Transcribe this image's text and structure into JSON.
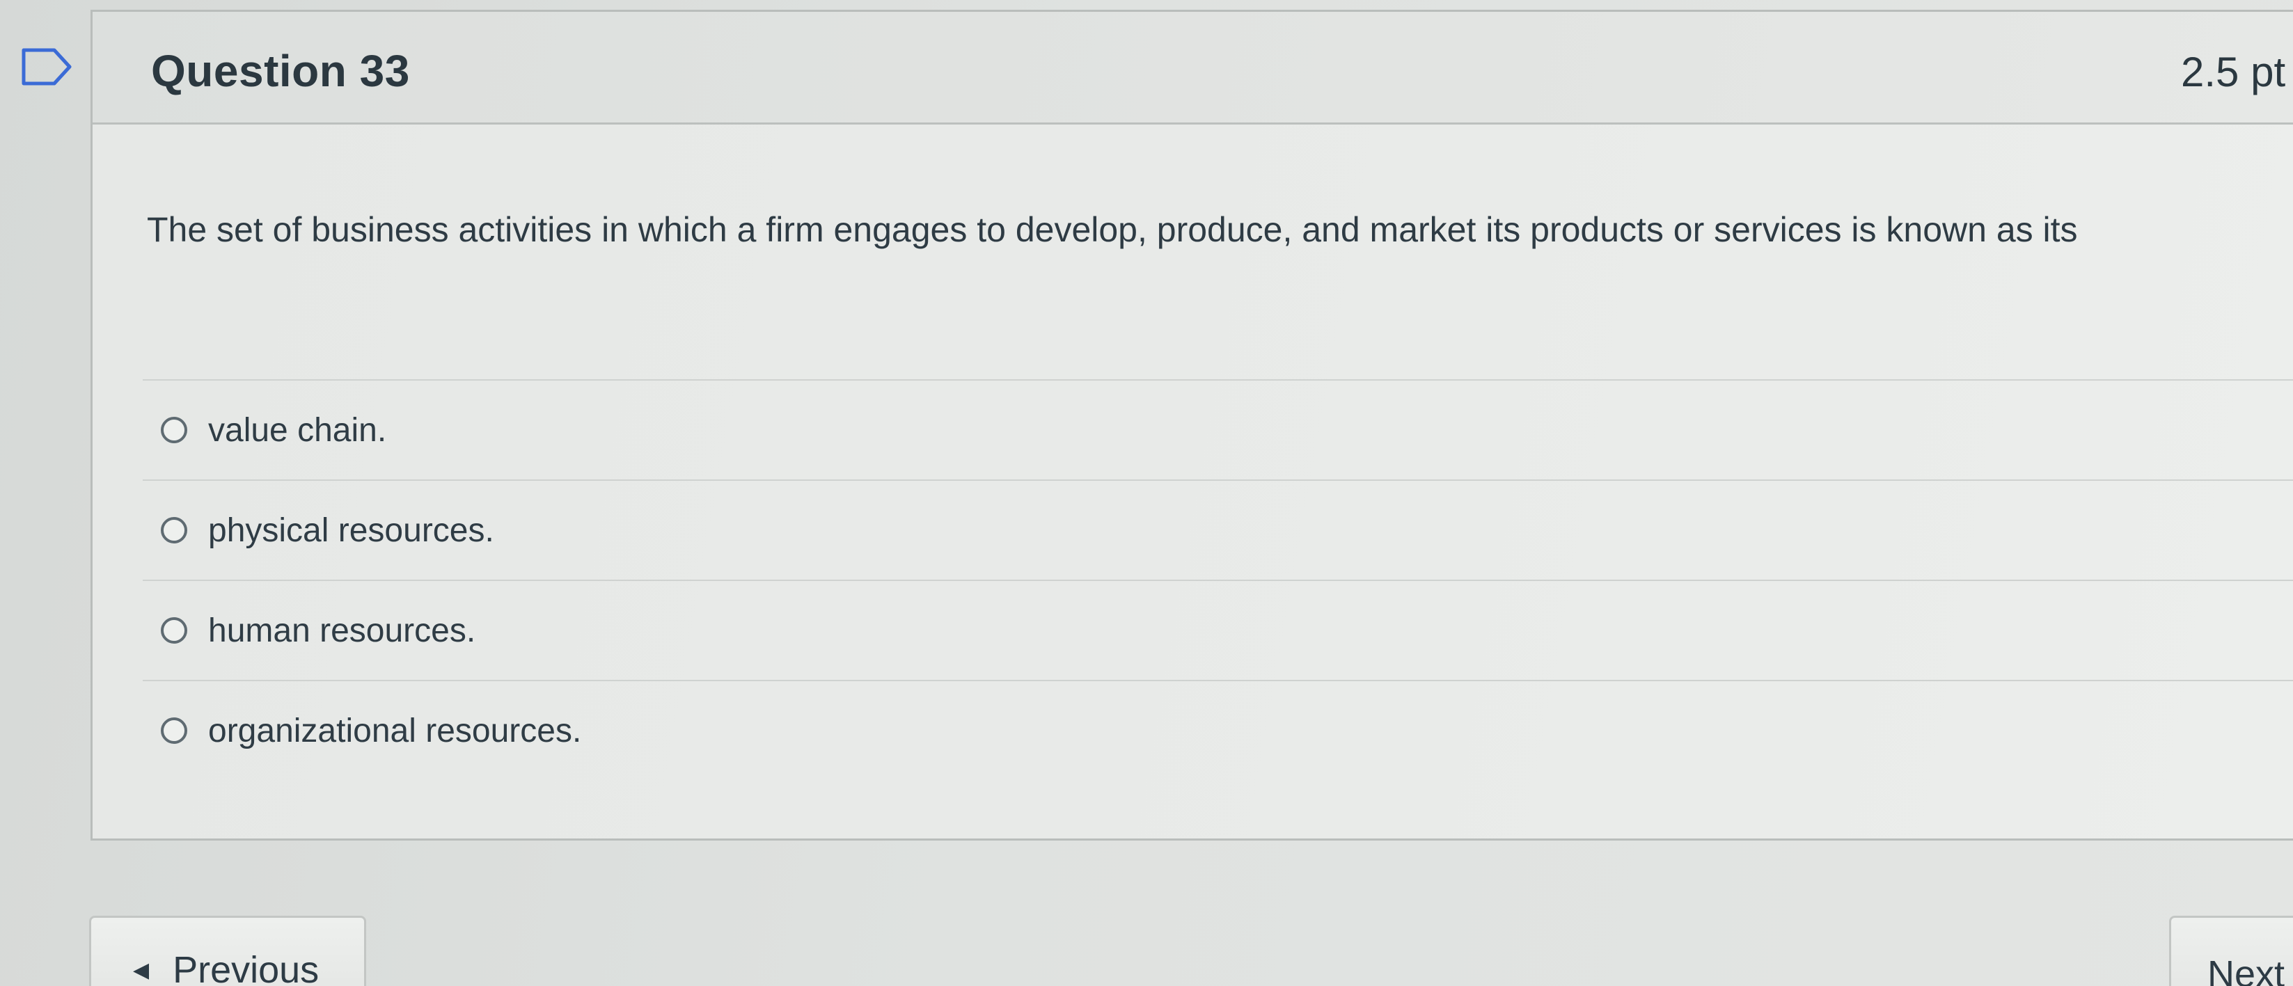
{
  "question": {
    "title": "Question 33",
    "points": "2.5 pt",
    "text": "The set of business activities in which a firm engages to develop, produce, and market its products or services is known as its"
  },
  "answers": [
    {
      "label": "value chain."
    },
    {
      "label": "physical resources."
    },
    {
      "label": "human resources."
    },
    {
      "label": "organizational resources."
    }
  ],
  "nav": {
    "previous_label": "Previous",
    "next_label": "Next"
  },
  "colors": {
    "text": "#2d3b45",
    "border": "#b9bdbb",
    "flag_outline": "#3b6bd6"
  },
  "icons": {
    "flag": "flag-icon",
    "previous": "caret-left-icon"
  }
}
